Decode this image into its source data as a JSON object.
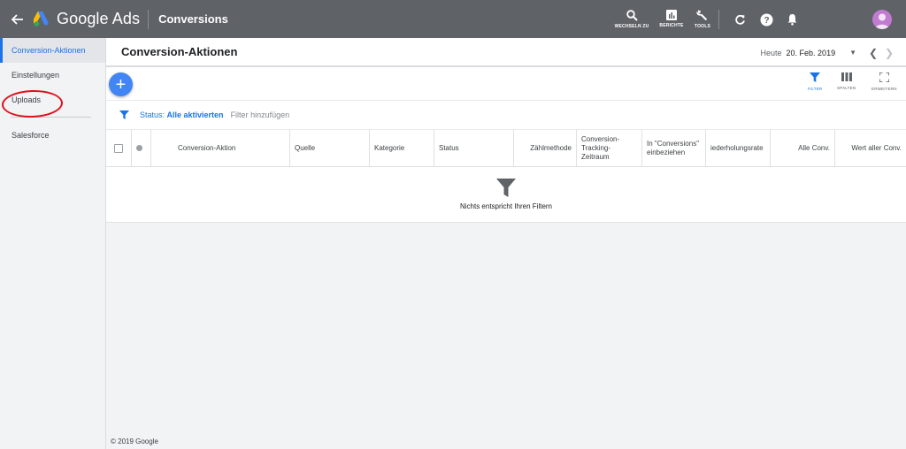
{
  "topbar": {
    "logo_text": "Google Ads",
    "title": "Conversions",
    "tools": [
      {
        "icon": "search-icon",
        "label": "WECHSELN ZU"
      },
      {
        "icon": "bar-chart-icon",
        "label": "BERICHTE"
      },
      {
        "icon": "wrench-icon",
        "label": "TOOLS"
      }
    ],
    "icons": [
      "refresh-icon",
      "help-icon",
      "bell-icon",
      "account-avatar"
    ]
  },
  "sidebar": {
    "items": [
      {
        "label": "Conversion-Aktionen",
        "active": true
      },
      {
        "label": "Einstellungen"
      },
      {
        "label": "Uploads"
      },
      {
        "label": "Salesforce"
      }
    ]
  },
  "main": {
    "title": "Conversion-Aktionen",
    "date_label": "Heute",
    "date_value": "20. Feb. 2019",
    "toolbar": {
      "filter": "FILTER",
      "columns": "SPALTEN",
      "expand": "ERWEITERN"
    },
    "filterbar": {
      "status_prefix": "Status:",
      "status_value": "Alle aktivierten",
      "add_filter": "Filter hinzufügen"
    },
    "columns": [
      "Conversion-Aktion",
      "Quelle",
      "Kategorie",
      "Status",
      "Zählmethode",
      "Conversion-Tracking-Zeitraum",
      "In \"Conversions\" einbeziehen",
      "iederholungsrate",
      "Alle Conv.",
      "Wert aller Conv."
    ],
    "empty_text": "Nichts entspricht Ihren Filtern"
  },
  "footer": "© 2019 Google",
  "colors": {
    "topbar": "#5f6368",
    "accent": "#1a73e8",
    "fab": "#4285f4",
    "annotation": "#e0101e"
  }
}
